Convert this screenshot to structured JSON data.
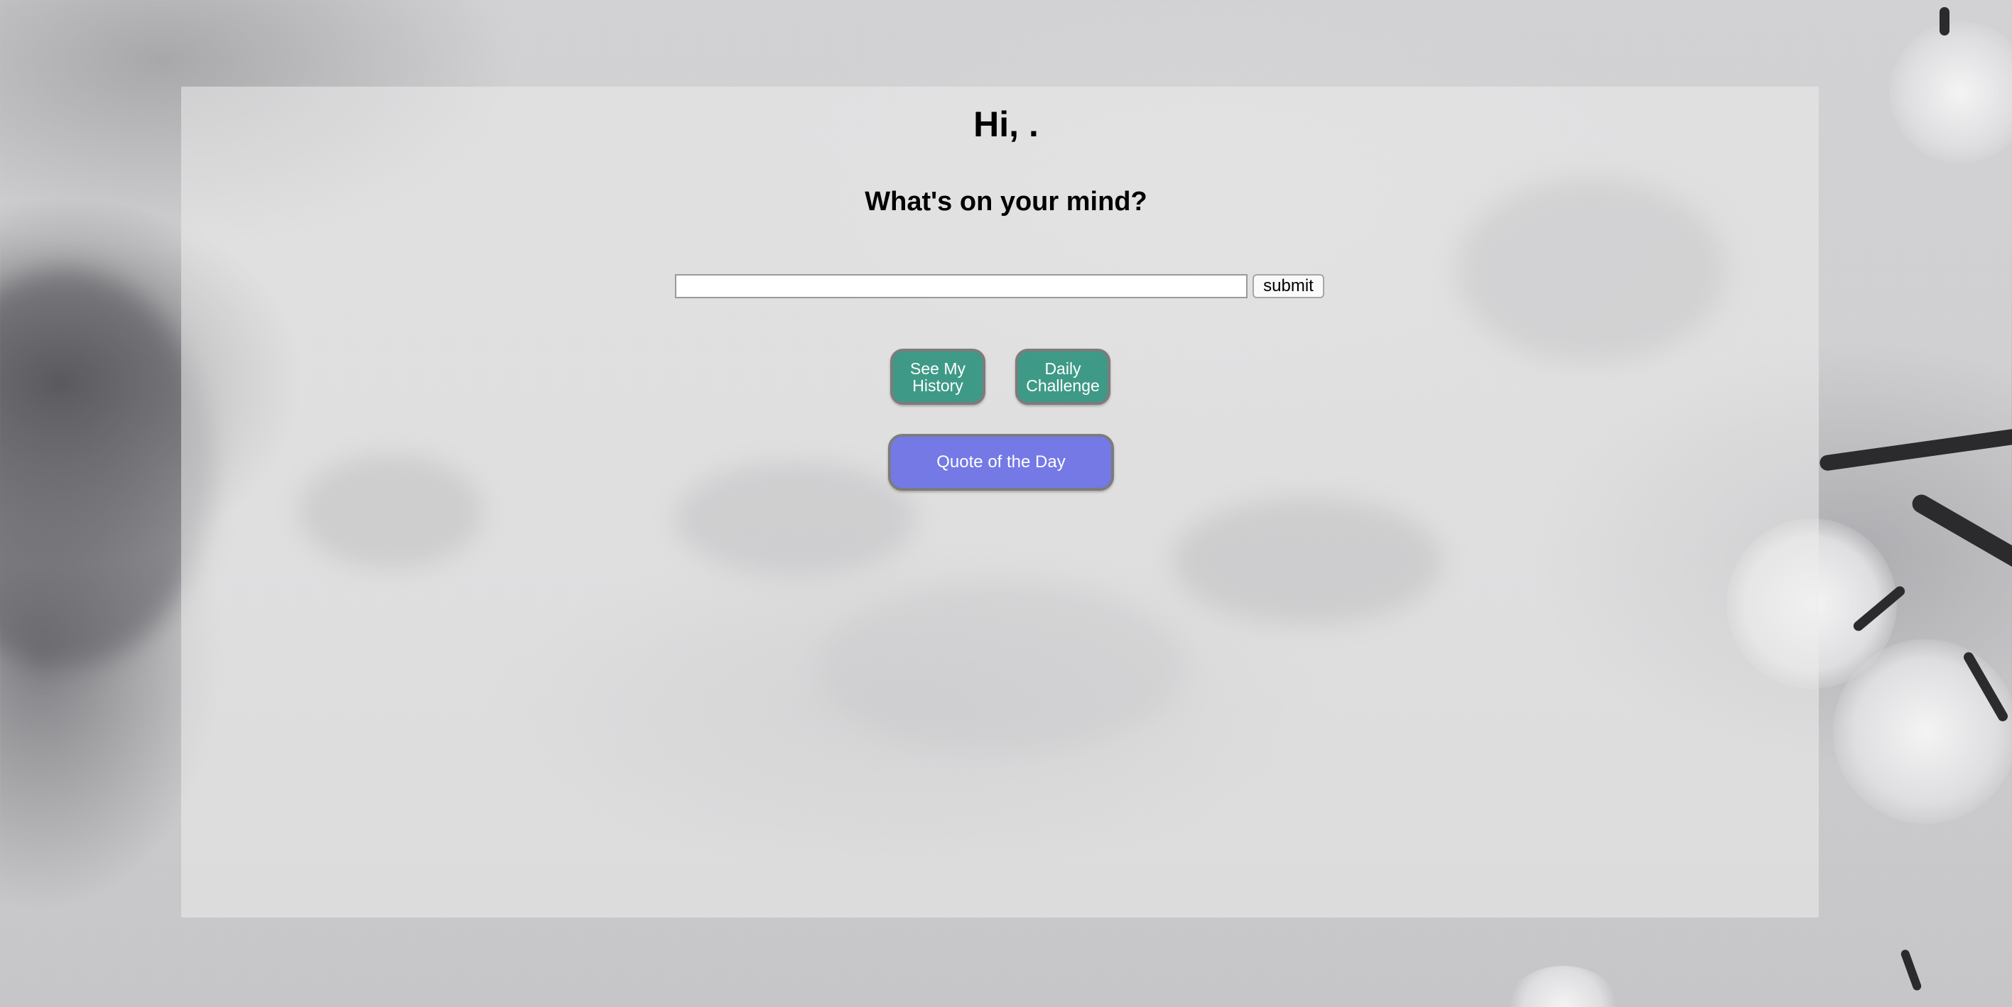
{
  "header": {
    "greeting": "Hi, .",
    "prompt": "What's on your mind?"
  },
  "entry": {
    "value": "",
    "placeholder": "",
    "submit_label": "submit"
  },
  "actions": {
    "history_label": "See My History",
    "challenge_label": "Daily Challenge",
    "quote_label": "Quote of the Day"
  },
  "colors": {
    "teal_button": "#3e9a86",
    "quote_button": "#7479e6",
    "button_border": "#7c7c7c"
  },
  "background": {
    "description_icon": "blurred-cherry-blossom-photo"
  }
}
